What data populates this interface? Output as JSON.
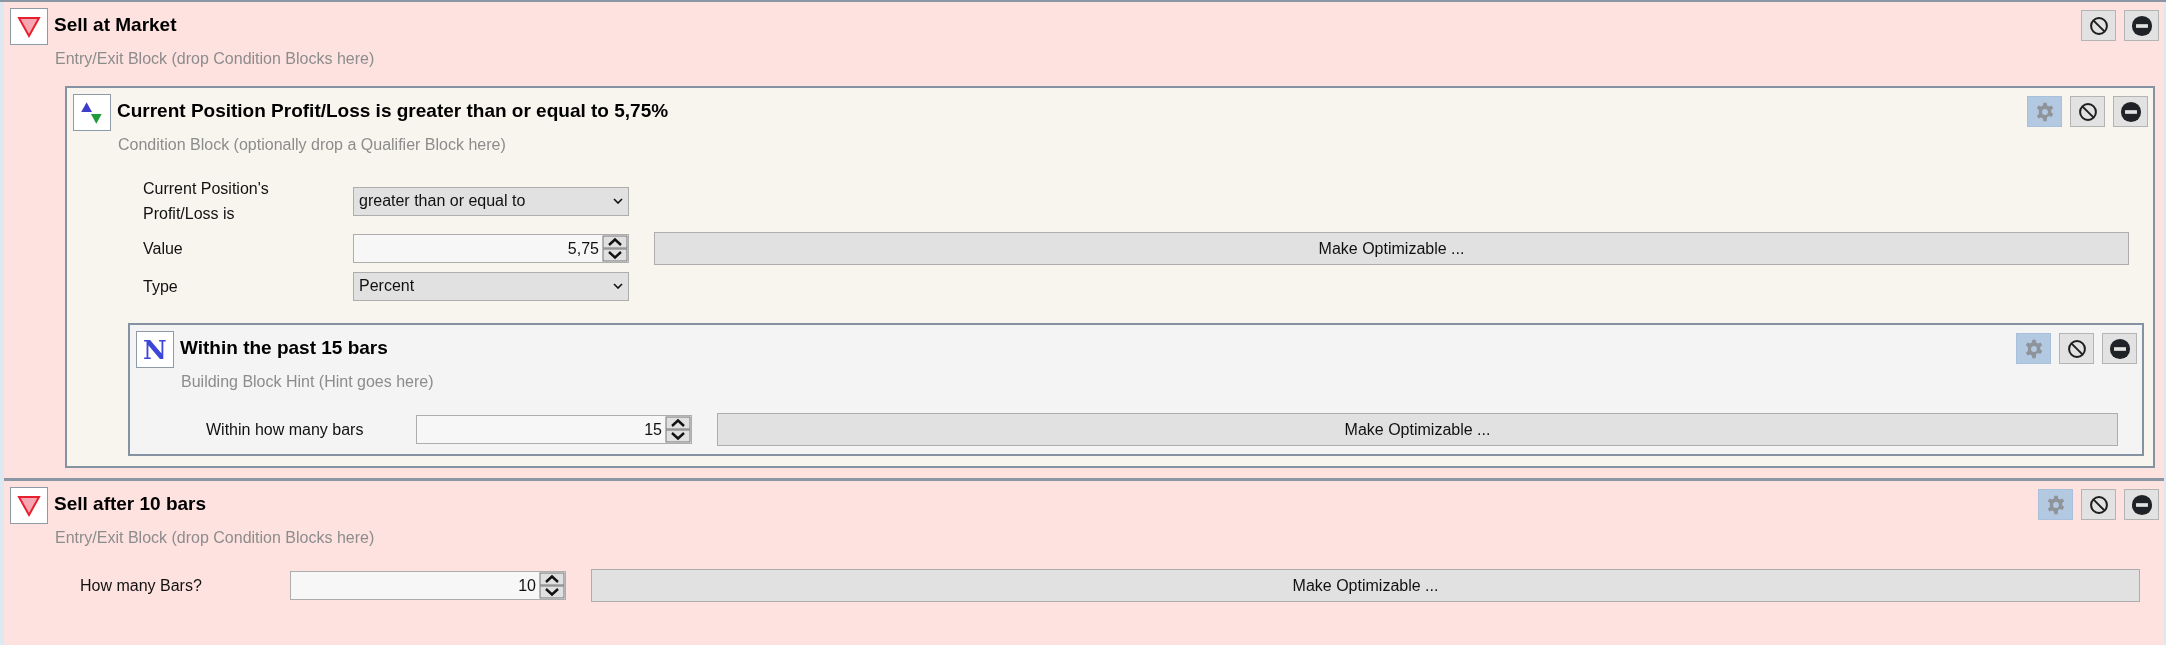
{
  "blocks": [
    {
      "kind": "entry_exit",
      "title": "Sell at Market",
      "hint": "Entry/Exit Block (drop Condition Blocks here)",
      "buttons": [
        {
          "kind": "disable"
        },
        {
          "kind": "remove"
        }
      ],
      "children": [
        {
          "kind": "condition",
          "title": "Current Position Profit/Loss is greater than or equal to 5,75%",
          "hint": "Condition Block (optionally drop a Qualifier Block here)",
          "buttons": [
            {
              "kind": "settings"
            },
            {
              "kind": "disable"
            },
            {
              "kind": "remove"
            }
          ],
          "fields": [
            {
              "kind": "select",
              "label": "Current Position's Profit/Loss is",
              "value": "greater than or equal to"
            },
            {
              "kind": "spinner",
              "label": "Value",
              "value": "5,75",
              "action": "Make Optimizable ..."
            },
            {
              "kind": "select",
              "label": "Type",
              "value": "Percent"
            }
          ],
          "children": [
            {
              "kind": "qualifier",
              "icon_letter": "N",
              "title": "Within the past 15 bars",
              "hint": "Building Block Hint (Hint goes here)",
              "buttons": [
                {
                  "kind": "settings"
                },
                {
                  "kind": "disable"
                },
                {
                  "kind": "remove"
                }
              ],
              "fields": [
                {
                  "kind": "spinner",
                  "label": "Within how many bars",
                  "value": "15",
                  "action": "Make Optimizable ..."
                }
              ]
            }
          ]
        }
      ]
    },
    {
      "kind": "entry_exit",
      "title": "Sell after 10 bars",
      "hint": "Entry/Exit Block (drop Condition Blocks here)",
      "buttons": [
        {
          "kind": "settings"
        },
        {
          "kind": "disable"
        },
        {
          "kind": "remove"
        }
      ],
      "fields": [
        {
          "kind": "spinner",
          "label": "How many Bars?",
          "value": "10",
          "action": "Make Optimizable ..."
        }
      ]
    }
  ]
}
